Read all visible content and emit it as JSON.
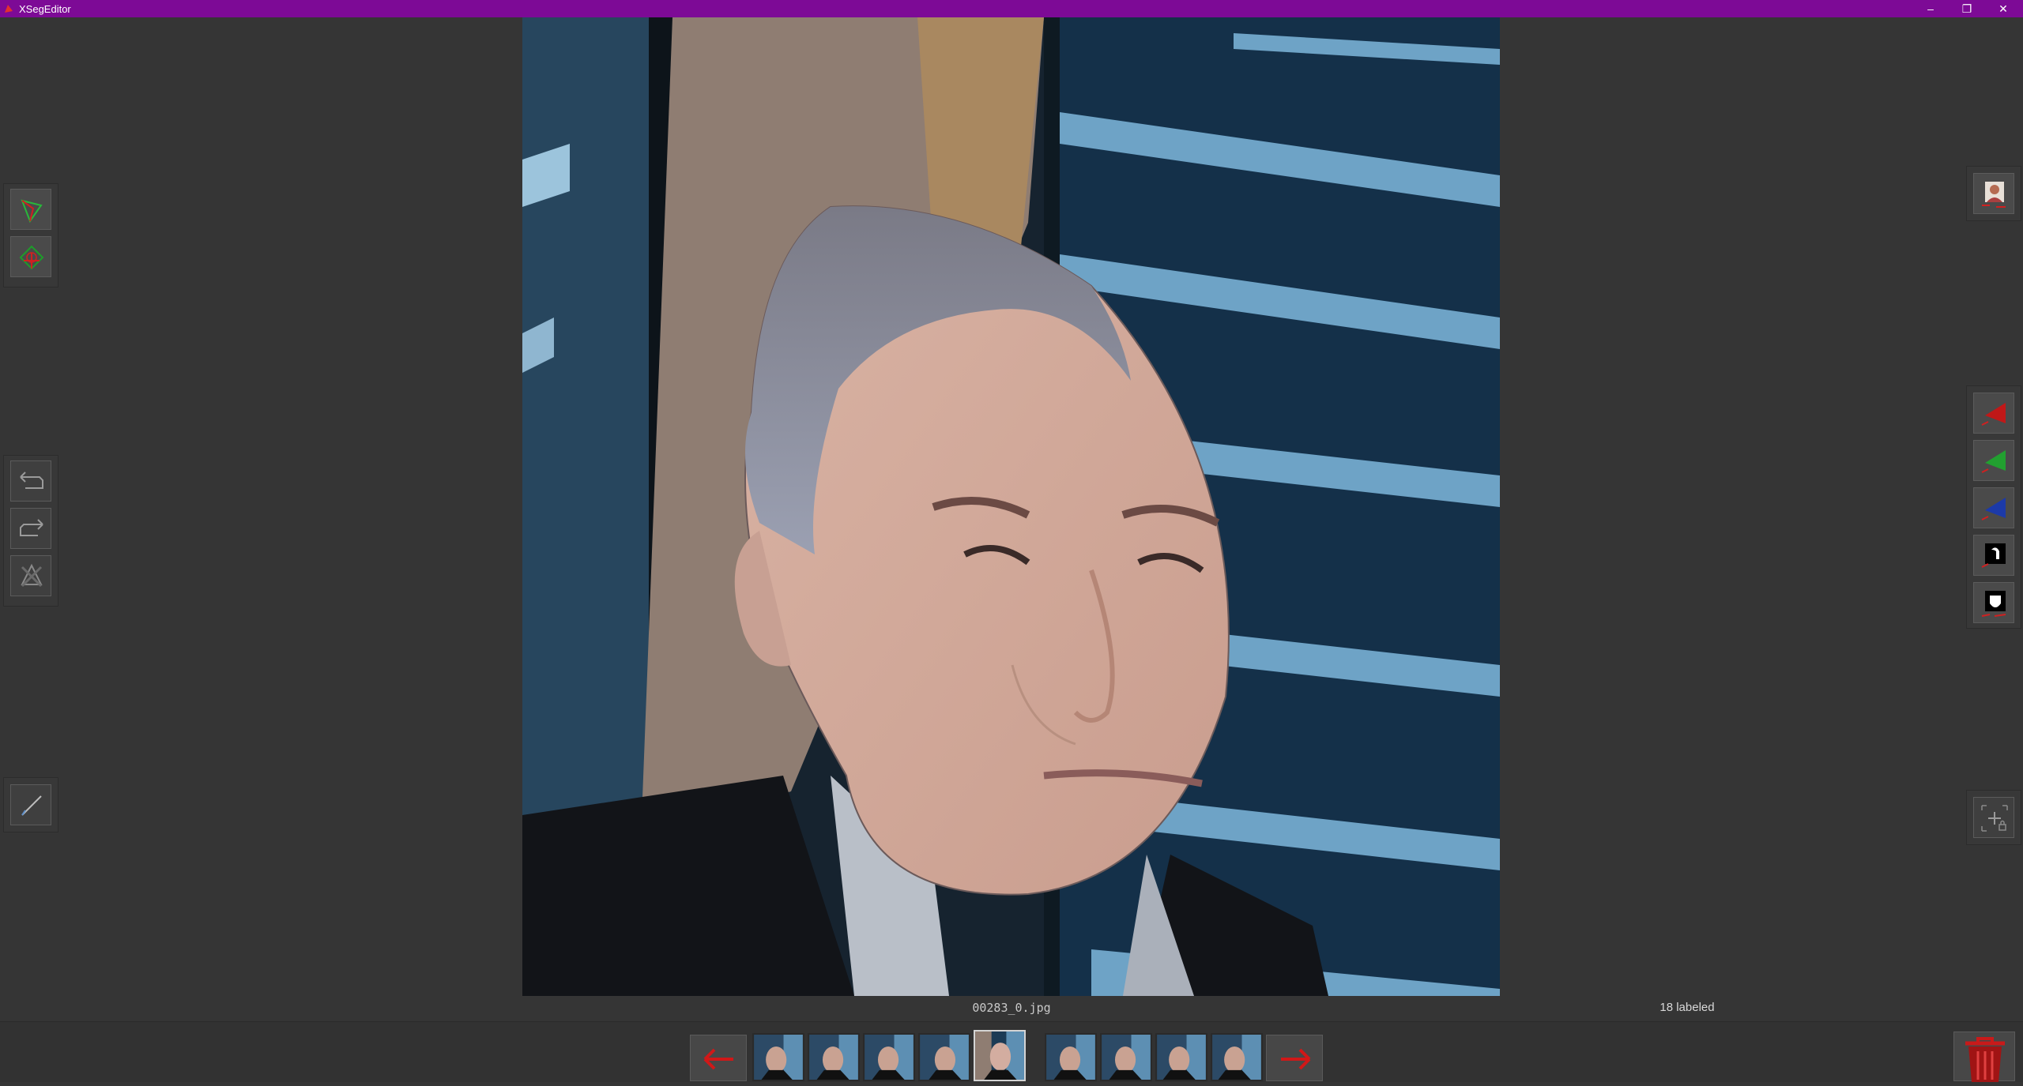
{
  "window": {
    "title": "XSegEditor",
    "minimize_glyph": "–",
    "restore_glyph": "❐",
    "close_glyph": "✕"
  },
  "left_toolbar": {
    "group1": [
      "poly-include-icon",
      "poly-exclude-icon"
    ],
    "group2": [
      "undo-point-icon",
      "redo-point-icon",
      "delete-poly-icon"
    ],
    "group3": [
      "pen-icon"
    ]
  },
  "right_toolbar": {
    "group1": [
      "view-faceset-icon"
    ],
    "group2": [
      "view-baseimage-icon",
      "view-lr-icon",
      "view-xseg-mask-icon",
      "view-xseg-overlay-icon",
      "view-mask-icon"
    ],
    "group3": [
      "lock-cursor-icon"
    ]
  },
  "colors": {
    "titlebar": "#7d0a96",
    "background": "#353535",
    "include": "#1e9c2a",
    "exclude": "#c21a1a",
    "nav_arrow": "#d01818"
  },
  "status": {
    "filename": "00283_0.jpg",
    "labeled": "18 labeled"
  },
  "thumbnails": {
    "count": 9,
    "selected_index": 4
  }
}
